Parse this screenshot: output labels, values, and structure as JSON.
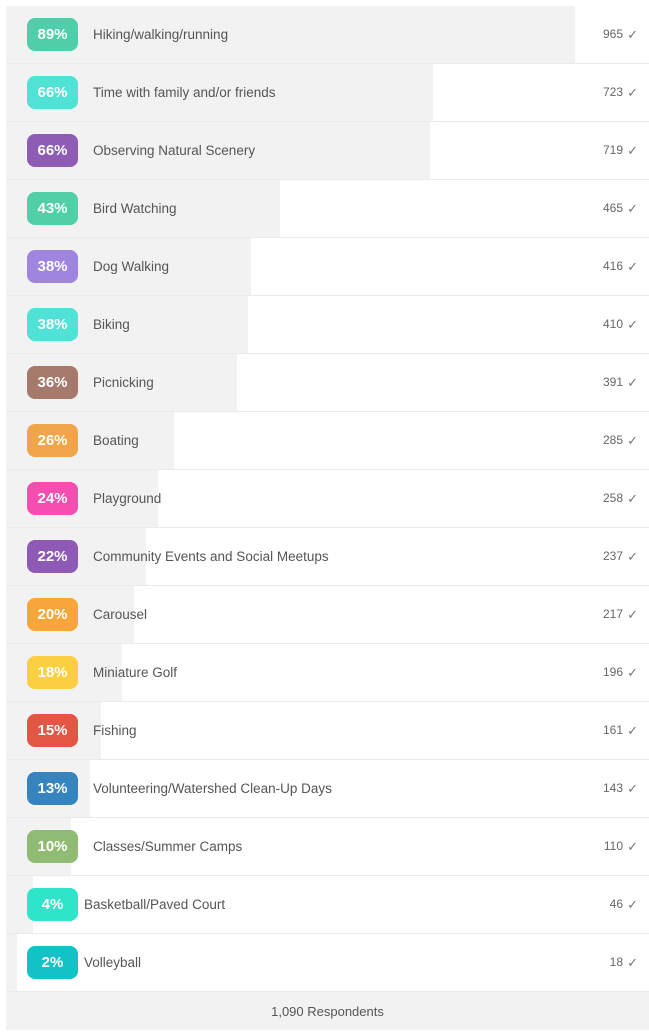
{
  "chart_data": {
    "type": "bar",
    "categories": [
      "Hiking/walking/running",
      "Time with family and/or friends",
      "Observing Natural Scenery",
      "Bird Watching",
      "Dog Walking",
      "Biking",
      "Picnicking",
      "Boating",
      "Playground",
      "Community Events and Social Meetups",
      "Carousel",
      "Miniature Golf",
      "Fishing",
      "Volunteering/Watershed Clean-Up Days",
      "Classes/Summer Camps",
      "Basketball/Paved Court",
      "Volleyball"
    ],
    "percent_labels": [
      "89%",
      "66%",
      "66%",
      "43%",
      "38%",
      "38%",
      "36%",
      "26%",
      "24%",
      "22%",
      "20%",
      "18%",
      "15%",
      "13%",
      "10%",
      "4%",
      "2%"
    ],
    "values": [
      965,
      723,
      719,
      465,
      416,
      410,
      391,
      285,
      258,
      237,
      217,
      196,
      161,
      143,
      110,
      46,
      18
    ],
    "badge_colors": [
      "#4fcea9",
      "#4fe2d5",
      "#8e5bb5",
      "#50cfa9",
      "#9f85df",
      "#50e2d6",
      "#a57a6c",
      "#f0a54a",
      "#f34eb0",
      "#8f5ab6",
      "#f8a53a",
      "#fccf43",
      "#e35643",
      "#3584bd",
      "#8fbb74",
      "#2ee5ca",
      "#13c2c6"
    ],
    "total": 1090,
    "value_scale_max": 1090
  },
  "footer": {
    "respondents": "1,090 Respondents"
  },
  "icons": {
    "check": "✓"
  }
}
